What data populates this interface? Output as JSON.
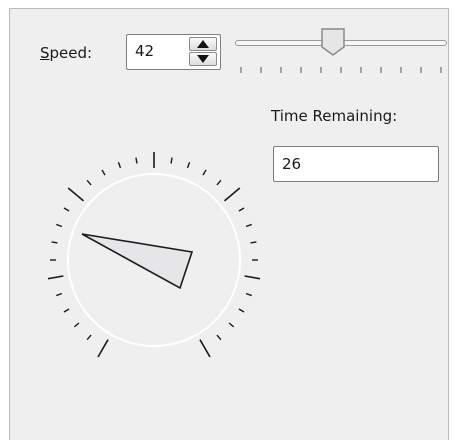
{
  "speed": {
    "label_mnemonic": "S",
    "label_rest": "peed:",
    "value": "42",
    "up_icon": "arrow-up-icon",
    "down_icon": "arrow-down-icon"
  },
  "slider": {
    "value": 42,
    "min": 0,
    "max": 100,
    "tick_count": 11
  },
  "time_remaining": {
    "label": "Time Remaining:",
    "value": "26"
  },
  "dial": {
    "pointer_icon": "dial-pointer-icon"
  }
}
